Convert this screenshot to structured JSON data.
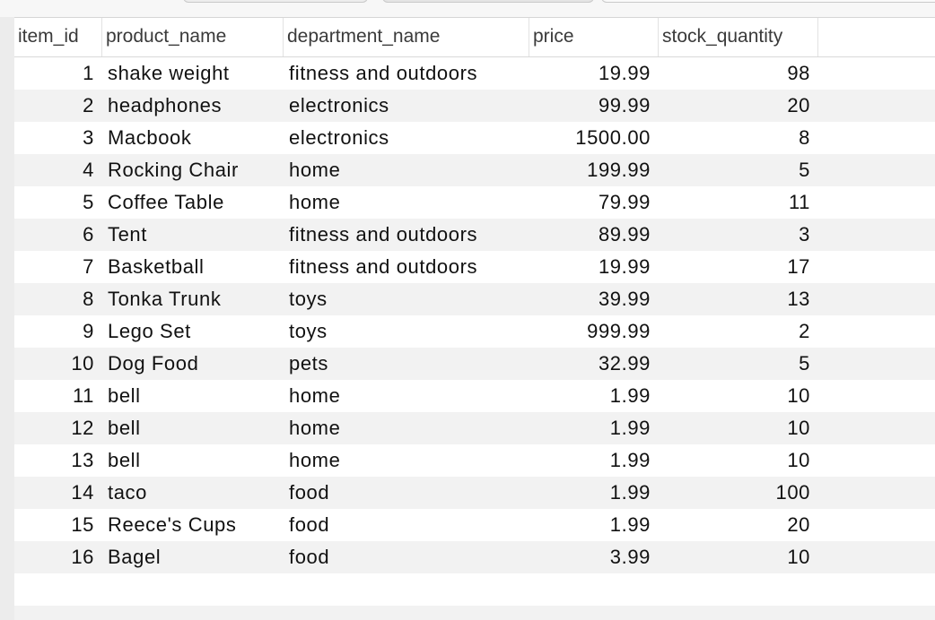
{
  "table": {
    "columns": [
      "item_id",
      "product_name",
      "department_name",
      "price",
      "stock_quantity"
    ],
    "rows": [
      [
        "1",
        "shake weight",
        "fitness and outdoors",
        "19.99",
        "98"
      ],
      [
        "2",
        "headphones",
        "electronics",
        "99.99",
        "20"
      ],
      [
        "3",
        "Macbook",
        "electronics",
        "1500.00",
        "8"
      ],
      [
        "4",
        "Rocking Chair",
        "home",
        "199.99",
        "5"
      ],
      [
        "5",
        "Coffee Table",
        "home",
        "79.99",
        "11"
      ],
      [
        "6",
        "Tent",
        "fitness and outdoors",
        "89.99",
        "3"
      ],
      [
        "7",
        "Basketball",
        "fitness and outdoors",
        "19.99",
        "17"
      ],
      [
        "8",
        "Tonka Trunk",
        "toys",
        "39.99",
        "13"
      ],
      [
        "9",
        "Lego Set",
        "toys",
        "999.99",
        "2"
      ],
      [
        "10",
        "Dog Food",
        "pets",
        "32.99",
        "5"
      ],
      [
        "11",
        "bell",
        "home",
        "1.99",
        "10"
      ],
      [
        "12",
        "bell",
        "home",
        "1.99",
        "10"
      ],
      [
        "13",
        "bell",
        "home",
        "1.99",
        "10"
      ],
      [
        "14",
        "taco",
        "food",
        "1.99",
        "100"
      ],
      [
        "15",
        "Reece's Cups",
        "food",
        "1.99",
        "20"
      ],
      [
        "16",
        "Bagel",
        "food",
        "3.99",
        "10"
      ]
    ]
  }
}
